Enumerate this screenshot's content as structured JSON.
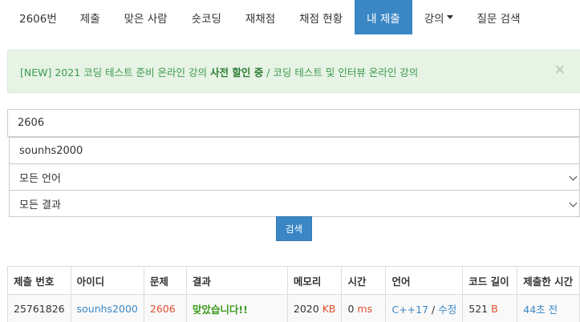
{
  "nav": {
    "problem": "2606번",
    "submit": "제출",
    "correct_users": "맞은 사람",
    "shortest": "숏코딩",
    "rejudge": "재채점",
    "grading_status": "채점 현황",
    "my_submissions": "내 제출",
    "lectures": "강의",
    "question_search": "질문 검색"
  },
  "alert": {
    "prefix": "[NEW] 2021 코딩 테스트 준비 온라인 강의",
    "highlight": "사전 할인 중",
    "suffix": "/ 코딩 테스트 및 인터뷰 온라인 강의",
    "close": "×"
  },
  "form": {
    "problem_id": "2606",
    "user_id": "sounhs2000",
    "language": "모든 언어",
    "result": "모든 결과",
    "search_label": "검색"
  },
  "table": {
    "headers": {
      "submission_id": "제출 번호",
      "user": "아이디",
      "problem": "문제",
      "result": "결과",
      "memory": "메모리",
      "time": "시간",
      "language": "언어",
      "code_length": "코드 길이",
      "submitted_at": "제출한 시간"
    },
    "rows": [
      {
        "submission_id": "25761826",
        "user": "sounhs2000",
        "problem": "2606",
        "result": "맞았습니다!!",
        "memory_value": "2020",
        "memory_unit": "KB",
        "time_value": "0",
        "time_unit": "ms",
        "language": "C++17",
        "language_sep": "/",
        "edit": "수정",
        "code_length_value": "521",
        "code_length_unit": "B",
        "submitted_at": "44초 전"
      }
    ]
  }
}
